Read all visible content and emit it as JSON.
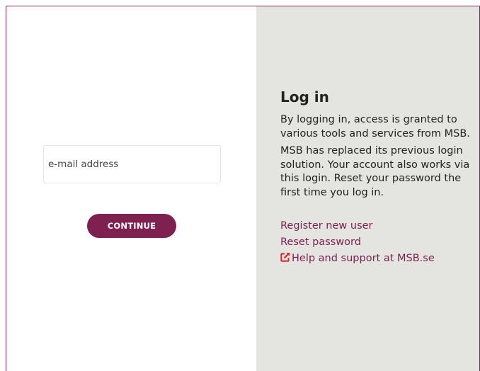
{
  "colors": {
    "brand": "#7e2151",
    "panel_background": "#e4e4e0",
    "external_icon": "#d7262b"
  },
  "login_form": {
    "email_placeholder": "e-mail address",
    "email_value": "",
    "continue_label": "CONTINUE"
  },
  "info": {
    "title": "Log in",
    "paragraphs": [
      "By logging in, access is granted to various tools and services from MSB.",
      "MSB has replaced its previous login solution. Your account also works via this login. Reset your password the first time you log in."
    ],
    "links": {
      "register": "Register new user",
      "reset": "Reset password",
      "help": "Help and support at MSB.se",
      "help_icon": "external-link-icon"
    }
  }
}
